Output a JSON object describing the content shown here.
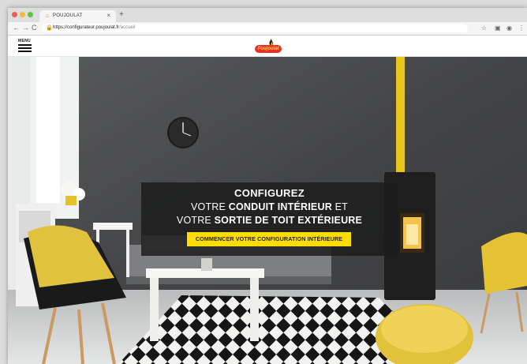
{
  "browser": {
    "tab_title": "POUJOULAT",
    "tab_close": "×",
    "new_tab": "+",
    "url_domain": "https://configurateur.poujoulat.fr",
    "url_path": "/accueil",
    "back": "←",
    "forward": "→",
    "reload": "C",
    "lock": "🔒",
    "star": "☆",
    "menu": "⋮"
  },
  "site": {
    "menu_label": "MENU",
    "logo_text": "Poujoulat",
    "icons": [
      "hamburger-icon",
      "flame-logo-icon",
      "clock-icon"
    ]
  },
  "hero": {
    "line1": "CONFIGUREZ",
    "line2_pre": "VOTRE ",
    "line2_bold": "CONDUIT INTÉRIEUR",
    "line2_post": " ET",
    "line3_pre": "VOTRE ",
    "line3_bold": "SORTIE DE TOIT EXTÉRIEURE",
    "cta_label": "COMMENCER VOTRE CONFIGURATION INTÉRIEURE"
  },
  "colors": {
    "accent": "#ffdd00",
    "brand_red": "#e8302a",
    "overlay": "#1c1c1c"
  }
}
